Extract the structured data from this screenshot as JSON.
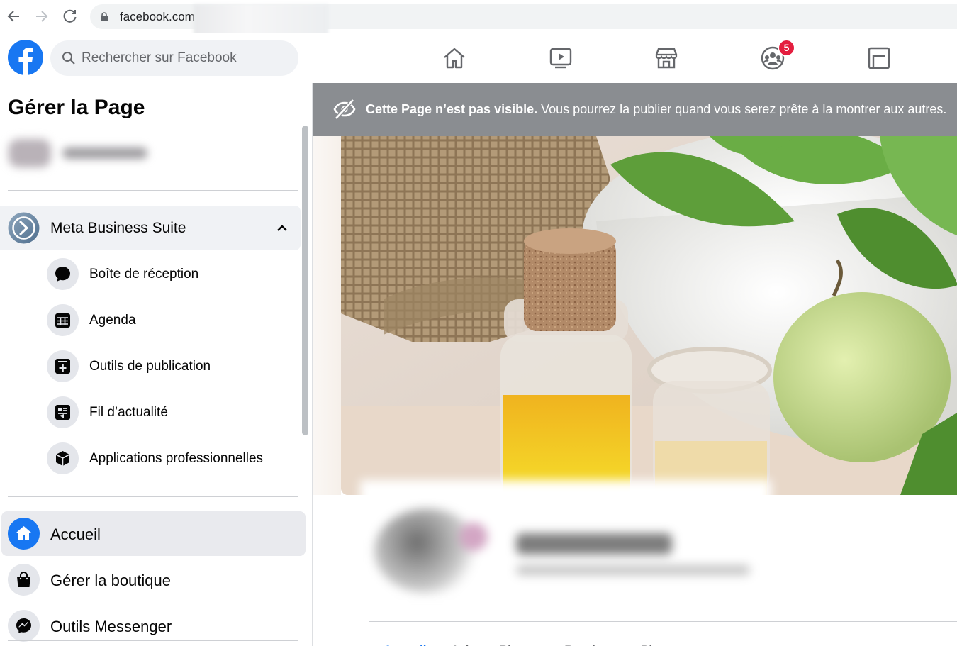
{
  "browser": {
    "url_domain": "facebook.com"
  },
  "header": {
    "search_placeholder": "Rechercher sur Facebook",
    "notification_badge": "5",
    "nav_icons": [
      "home-icon",
      "watch-icon",
      "marketplace-icon",
      "groups-icon",
      "gaming-icon"
    ],
    "brand_color": "#1877f2"
  },
  "sidebar": {
    "title": "Gérer la Page",
    "meta_business_suite": {
      "label": "Meta Business Suite",
      "expanded": true,
      "items": [
        {
          "label": "Boîte de réception",
          "icon": "chat-bubble-icon"
        },
        {
          "label": "Agenda",
          "icon": "calendar-icon"
        },
        {
          "label": "Outils de publication",
          "icon": "publishing-tools-icon"
        },
        {
          "label": "Fil d’actualité",
          "icon": "news-feed-icon"
        },
        {
          "label": "Applications professionnelles",
          "icon": "box-icon"
        }
      ]
    },
    "main_items": [
      {
        "label": "Accueil",
        "icon": "home-icon",
        "active": true
      },
      {
        "label": "Gérer la boutique",
        "icon": "shopping-bag-icon",
        "active": false
      },
      {
        "label": "Outils Messenger",
        "icon": "messenger-icon",
        "active": false
      }
    ]
  },
  "main": {
    "banner": {
      "bold": "Cette Page n’est pas visible.",
      "text": " Vous pourrez la publier quand vous serez prête à la montrer aux autres.",
      "color": "#8a8d91"
    },
    "tabs": [
      "Accueil",
      "Avis",
      "Photos",
      "Boutique",
      "Plus"
    ]
  }
}
